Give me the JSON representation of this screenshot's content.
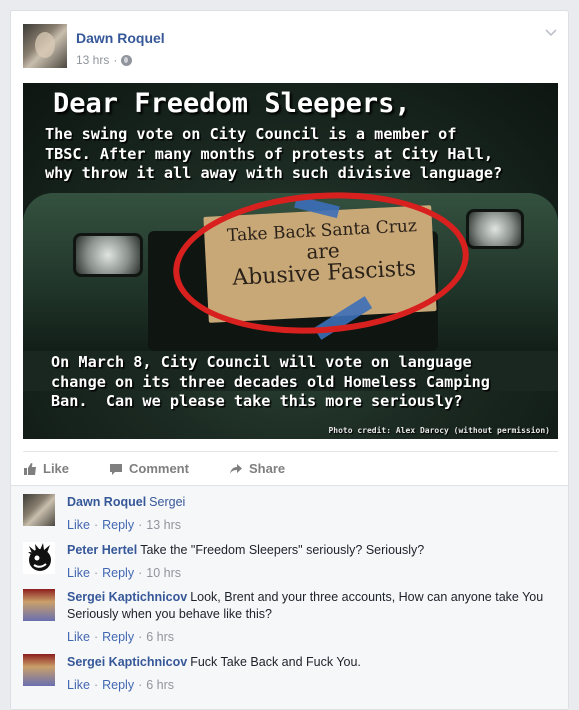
{
  "post": {
    "author": "Dawn Roquel",
    "time": "13 hrs",
    "meta_sep": "·",
    "photo": {
      "title": "Dear Freedom Sleepers,",
      "top_text": "The swing vote on City Council is a member of\nTBSC. After many months of protests at City Hall,\nwhy throw it all away with such divisive language?",
      "sign_line1": "Take Back Santa Cruz",
      "sign_line2": "are",
      "sign_line3": "Abusive Fascists",
      "bottom_text": "On March 8, City Council will vote on language\nchange on its three decades old Homeless Camping\nBan.  Can we please take this more seriously?",
      "credit": "Photo credit: Alex Darocy (without permission)"
    },
    "actions": {
      "like": "Like",
      "comment": "Comment",
      "share": "Share"
    }
  },
  "comments": [
    {
      "author": "Dawn Roquel",
      "text": "Sergei",
      "like": "Like",
      "reply": "Reply",
      "time": "13 hrs"
    },
    {
      "author": "Peter Hertel",
      "text": "Take the \"Freedom Sleepers\" seriously? Seriously?",
      "like": "Like",
      "reply": "Reply",
      "time": "10 hrs"
    },
    {
      "author": "Sergei Kaptichnicov",
      "text": "Look, Brent and your three accounts, How can anyone take You Seriously when you behave like this?",
      "like": "Like",
      "reply": "Reply",
      "time": "6 hrs"
    },
    {
      "author": "Sergei Kaptichnicov",
      "text": "Fuck Take Back and Fuck You.",
      "like": "Like",
      "reply": "Reply",
      "time": "6 hrs"
    }
  ],
  "colors": {
    "link": "#365899",
    "muted": "#90949c",
    "ring": "#d8211f"
  }
}
